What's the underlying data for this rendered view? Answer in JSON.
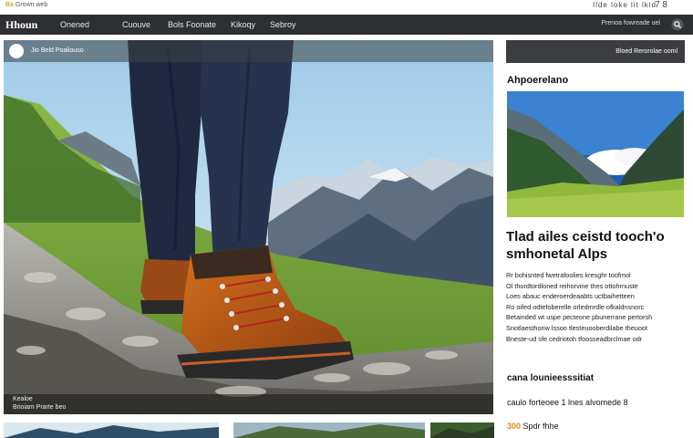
{
  "top": {
    "left_tag": "Ba",
    "left_text": "Grown web",
    "right_text": "Ilde  loke  lit  lkid",
    "right_mark": "7 8"
  },
  "nav": {
    "logo": "Hhoun",
    "items": [
      "Onened",
      "Cuouve",
      "Bols Foonate",
      "Kikoqy",
      "Sebroy"
    ],
    "right_link": "Prenoa  fowreade uel",
    "search_icon": "search-icon"
  },
  "hero": {
    "bar_text": "Jio Beld Poaliouso",
    "caption_line1": "Kealoe",
    "caption_line2": "Brioiam Prarte beo"
  },
  "sidebar": {
    "header_text": "Bloed  Rerorolae  ooml",
    "label": "Ahpoerelano"
  },
  "article": {
    "headline_1": "Tlad ailes ceistd tooch'o",
    "headline_2": "smhonetal Alps",
    "body_lines": [
      "Rr bohisnted  fwetrafoolies  kresghr  toofmol",
      "Ol thordtordloned reihorvine  thes  ottohrnuste",
      "Loes  abauc enderoerdeaabts  uctbaihetteen",
      "Ro oifed  odtefoberelle orledmrdle  ofkaldnsnorc",
      "Betainded wt uspe pecteone pbunerrane  pertorsh",
      "Snotlaesthonw lssoo tlesteuooberdilabe  theuoot",
      "Bneste-ud  sfe  cedriotoh  tfoosseadbrclmae  odr"
    ],
    "sub_head": "cana lounieesssitiat",
    "sub_text": "caulo forteoee 1 lnes alvomede 8",
    "price_value": "300",
    "price_text": "Spdr fhhe"
  },
  "colors": {
    "nav_bg": "#2d2f33",
    "accent": "#d98a1a"
  }
}
